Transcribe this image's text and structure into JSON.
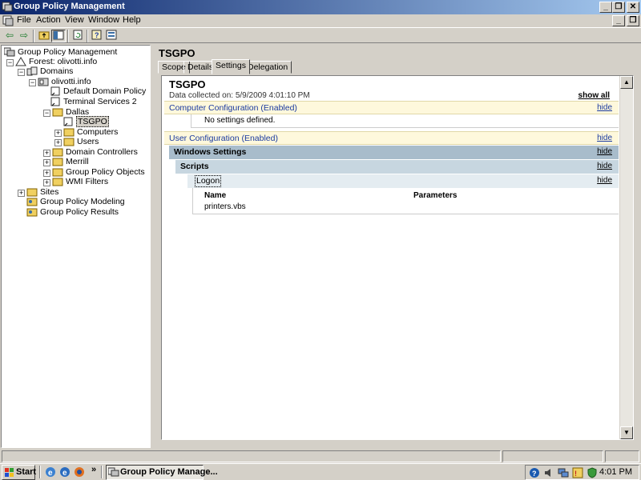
{
  "window": {
    "title": "Group Policy Management"
  },
  "menu": {
    "items": [
      "File",
      "Action",
      "View",
      "Window",
      "Help"
    ]
  },
  "tree": {
    "root": "Group Policy Management",
    "forest": "Forest: olivotti.info",
    "domains": "Domains",
    "domain": "olivotti.info",
    "default_policy": "Default Domain Policy",
    "ts2": "Terminal Services 2",
    "dallas": "Dallas",
    "tsgpo": "TSGPO",
    "computers": "Computers",
    "users": "Users",
    "dcs": "Domain Controllers",
    "merrill": "Merrill",
    "gpo": "Group Policy Objects",
    "wmi": "WMI Filters",
    "sites": "Sites",
    "modeling": "Group Policy Modeling",
    "results": "Group Policy Results"
  },
  "right": {
    "title": "TSGPO",
    "tabs": [
      "Scope",
      "Details",
      "Settings",
      "Delegation"
    ],
    "active_tab": "Settings"
  },
  "report": {
    "title": "TSGPO",
    "collected": "Data collected on: 5/9/2009 4:01:10 PM",
    "show_all": "show all",
    "computer_config": "Computer Configuration (Enabled)",
    "no_settings": "No settings defined.",
    "user_config": "User Configuration (Enabled)",
    "windows_settings": "Windows Settings",
    "scripts": "Scripts",
    "logon": "Logon",
    "col_name": "Name",
    "col_params": "Parameters",
    "script_name": "printers.vbs",
    "hide": "hide"
  },
  "taskbar": {
    "start": "Start",
    "task": "Group Policy Manage...",
    "clock": "4:01 PM",
    "chevron": "»"
  },
  "colors": {
    "title_start": "#0a246a",
    "title_end": "#a6caf0",
    "link": "#1a3aa0"
  }
}
